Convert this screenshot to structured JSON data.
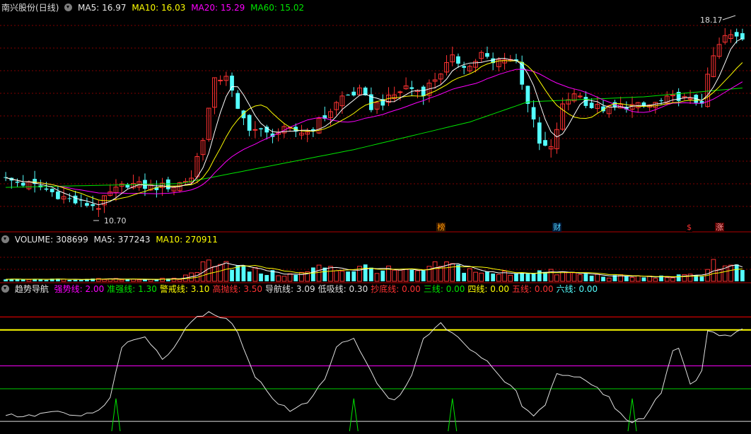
{
  "colors": {
    "up": "#ff3232",
    "down": "#54ffff",
    "ma5": "#ffffff",
    "ma10": "#ffff00",
    "ma20": "#ff00ff",
    "ma60": "#00e600",
    "grid": "#800000",
    "sep": "#b00000",
    "bg": "#000000"
  },
  "price_panel": {
    "stock_name": "南兴股份",
    "period": "(日线)",
    "ma5": {
      "label": "MA5:",
      "value": "16.97"
    },
    "ma10": {
      "label": "MA10:",
      "value": "16.03"
    },
    "ma20": {
      "label": "MA20:",
      "value": "15.29"
    },
    "ma60": {
      "label": "MA60:",
      "value": "15.02"
    },
    "high_label": "18.17",
    "low_label": "10.70"
  },
  "volume_panel": {
    "volume": {
      "label": "VOLUME:",
      "value": "308699"
    },
    "ma5": {
      "label": "MA5:",
      "value": "377243"
    },
    "ma10": {
      "label": "MA10:",
      "value": "270911"
    }
  },
  "indicator_panel": {
    "name": "趋势导航",
    "items": [
      {
        "label": "强势线:",
        "value": "2.00",
        "color": "#ff00ff"
      },
      {
        "label": "准强线:",
        "value": "1.30",
        "color": "#00e600"
      },
      {
        "label": "警戒线:",
        "value": "3.10",
        "color": "#ffff00"
      },
      {
        "label": "高抛线:",
        "value": "3.50",
        "color": "#ff3232"
      },
      {
        "label": "导航线:",
        "value": "3.09",
        "color": "#e0e0e0"
      },
      {
        "label": "低吸线:",
        "value": "0.30",
        "color": "#e0e0e0"
      },
      {
        "label": "抄底线:",
        "value": "0.00",
        "color": "#ff3232"
      },
      {
        "label": "三线:",
        "value": "0.00",
        "color": "#00e600"
      },
      {
        "label": "四线:",
        "value": "0.00",
        "color": "#ffff00"
      },
      {
        "label": "五线:",
        "value": "0.00",
        "color": "#ff3232"
      },
      {
        "label": "六线:",
        "value": "0.00",
        "color": "#54ffff"
      }
    ]
  },
  "badges": [
    {
      "text": "榜",
      "color": "#ff9900",
      "bg": "#3a1a00",
      "day": 75
    },
    {
      "text": "财",
      "color": "#54d8ff",
      "bg": "#001a3a",
      "day": 95
    },
    {
      "text": "$",
      "color": "#ff3232",
      "bg": "#000000",
      "day": 118
    },
    {
      "text": "涨",
      "color": "#ff9999",
      "bg": "#5a0000",
      "day": 123
    }
  ],
  "chart_data": {
    "type": "candlestick",
    "days": 128,
    "ylim": [
      10.0,
      18.6
    ],
    "anchors_close": [
      [
        0,
        11.9
      ],
      [
        6,
        11.6
      ],
      [
        12,
        11.0
      ],
      [
        16,
        10.85
      ],
      [
        18,
        11.35
      ],
      [
        21,
        11.75
      ],
      [
        25,
        11.6
      ],
      [
        29,
        11.65
      ],
      [
        32,
        12.0
      ],
      [
        34,
        13.6
      ],
      [
        36,
        15.8
      ],
      [
        38,
        16.1
      ],
      [
        40,
        14.6
      ],
      [
        42,
        14.0
      ],
      [
        45,
        13.7
      ],
      [
        48,
        13.85
      ],
      [
        52,
        13.8
      ],
      [
        55,
        14.4
      ],
      [
        58,
        15.2
      ],
      [
        61,
        15.4
      ],
      [
        63,
        14.8
      ],
      [
        66,
        15.1
      ],
      [
        69,
        15.6
      ],
      [
        72,
        15.4
      ],
      [
        75,
        16.2
      ],
      [
        77,
        16.7
      ],
      [
        80,
        16.4
      ],
      [
        82,
        16.9
      ],
      [
        84,
        16.5
      ],
      [
        86,
        16.8
      ],
      [
        88,
        16.6
      ],
      [
        90,
        15.0
      ],
      [
        92,
        13.3
      ],
      [
        94,
        13.1
      ],
      [
        96,
        14.8
      ],
      [
        98,
        15.4
      ],
      [
        101,
        14.8
      ],
      [
        104,
        14.7
      ],
      [
        107,
        14.85
      ],
      [
        110,
        14.8
      ],
      [
        113,
        15.0
      ],
      [
        116,
        15.2
      ],
      [
        118,
        15.0
      ],
      [
        120,
        15.05
      ],
      [
        122,
        16.8
      ],
      [
        124,
        17.6
      ],
      [
        127,
        17.55
      ]
    ],
    "ma60_anchors": [
      [
        0,
        11.6
      ],
      [
        30,
        11.75
      ],
      [
        40,
        12.2
      ],
      [
        60,
        13.1
      ],
      [
        80,
        14.2
      ],
      [
        90,
        15.0
      ],
      [
        110,
        15.2
      ],
      [
        127,
        15.55
      ]
    ],
    "volume": {
      "ylim": [
        0,
        800000
      ],
      "anchors": [
        [
          0,
          40000
        ],
        [
          30,
          50000
        ],
        [
          33,
          260000
        ],
        [
          35,
          420000
        ],
        [
          37,
          520000
        ],
        [
          40,
          300000
        ],
        [
          44,
          200000
        ],
        [
          50,
          130000
        ],
        [
          53,
          250000
        ],
        [
          56,
          370000
        ],
        [
          58,
          230000
        ],
        [
          62,
          300000
        ],
        [
          66,
          240000
        ],
        [
          70,
          190000
        ],
        [
          73,
          250000
        ],
        [
          75,
          370000
        ],
        [
          77,
          330000
        ],
        [
          80,
          250000
        ],
        [
          84,
          150000
        ],
        [
          88,
          200000
        ],
        [
          91,
          220000
        ],
        [
          94,
          190000
        ],
        [
          98,
          160000
        ],
        [
          104,
          110000
        ],
        [
          112,
          90000
        ],
        [
          118,
          120000
        ],
        [
          120,
          160000
        ],
        [
          122,
          420000
        ],
        [
          124,
          300000
        ],
        [
          127,
          280000
        ]
      ]
    },
    "indicator": {
      "ylim": [
        0,
        4.2
      ],
      "levels": [
        {
          "value": 3.5,
          "color": "#ff0000"
        },
        {
          "value": 3.1,
          "color": "#ffff00"
        },
        {
          "value": 2.0,
          "color": "#ff00ff"
        },
        {
          "value": 1.3,
          "color": "#00cc00"
        },
        {
          "value": 0.3,
          "color": "#e0e0e0"
        }
      ],
      "anchors": [
        [
          0,
          0.5
        ],
        [
          4,
          0.45
        ],
        [
          8,
          0.6
        ],
        [
          12,
          0.45
        ],
        [
          16,
          0.6
        ],
        [
          18,
          1.0
        ],
        [
          20,
          2.6
        ],
        [
          24,
          2.9
        ],
        [
          27,
          2.2
        ],
        [
          29,
          2.6
        ],
        [
          32,
          3.4
        ],
        [
          35,
          3.6
        ],
        [
          38,
          3.5
        ],
        [
          40,
          3.0
        ],
        [
          43,
          1.7
        ],
        [
          46,
          1.0
        ],
        [
          49,
          0.6
        ],
        [
          52,
          0.9
        ],
        [
          55,
          1.6
        ],
        [
          57,
          2.6
        ],
        [
          60,
          2.8
        ],
        [
          63,
          1.8
        ],
        [
          65,
          1.2
        ],
        [
          67,
          0.9
        ],
        [
          70,
          1.7
        ],
        [
          72,
          2.8
        ],
        [
          75,
          3.3
        ],
        [
          77,
          3.0
        ],
        [
          80,
          2.5
        ],
        [
          82,
          2.3
        ],
        [
          84,
          1.9
        ],
        [
          86,
          1.5
        ],
        [
          88,
          1.2
        ],
        [
          89,
          0.8
        ],
        [
          91,
          0.5
        ],
        [
          93,
          0.8
        ],
        [
          95,
          1.8
        ],
        [
          98,
          1.7
        ],
        [
          100,
          1.5
        ],
        [
          102,
          1.3
        ],
        [
          104,
          1.0
        ],
        [
          106,
          0.5
        ],
        [
          108,
          0.3
        ],
        [
          110,
          0.4
        ],
        [
          113,
          1.2
        ],
        [
          115,
          2.5
        ],
        [
          116,
          2.6
        ],
        [
          118,
          1.4
        ],
        [
          120,
          1.8
        ],
        [
          121,
          3.1
        ],
        [
          124,
          2.9
        ],
        [
          127,
          3.1
        ]
      ],
      "spikes": [
        {
          "day": 19,
          "value": 1.0
        },
        {
          "day": 60,
          "value": 1.0
        },
        {
          "day": 77,
          "value": 1.0
        },
        {
          "day": 108,
          "value": 1.0
        }
      ]
    }
  }
}
